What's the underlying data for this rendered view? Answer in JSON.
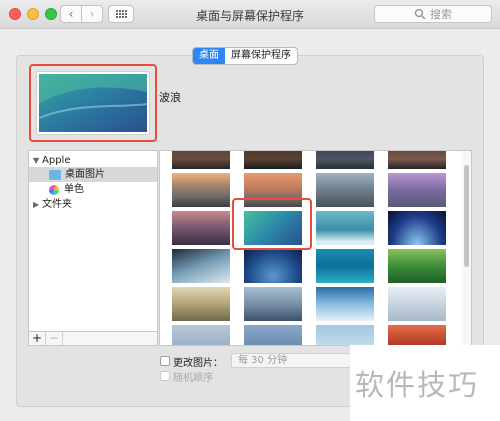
{
  "window": {
    "title": "桌面与屏幕保护程序",
    "search_placeholder": "搜索"
  },
  "tabs": [
    {
      "label": "桌面",
      "active": true
    },
    {
      "label": "屏幕保护程序",
      "active": false
    }
  ],
  "current": {
    "wallpaper_name": "波浪"
  },
  "sidebar": {
    "group_label": "Apple",
    "items": [
      {
        "label": "桌面图片",
        "icon": "folder-icon",
        "selected": true
      },
      {
        "label": "单色",
        "icon": "color-wheel-icon",
        "selected": false
      }
    ],
    "folders_label": "文件夹",
    "add_label": "+",
    "remove_label": "−"
  },
  "options": {
    "change_picture_label": "更改图片：",
    "interval_value": "每 30 分钟",
    "random_order_label": "随机顺序"
  },
  "watermark": "软件技巧",
  "colors": {
    "accent": "#2e86f2",
    "highlight": "#e74c3c"
  }
}
